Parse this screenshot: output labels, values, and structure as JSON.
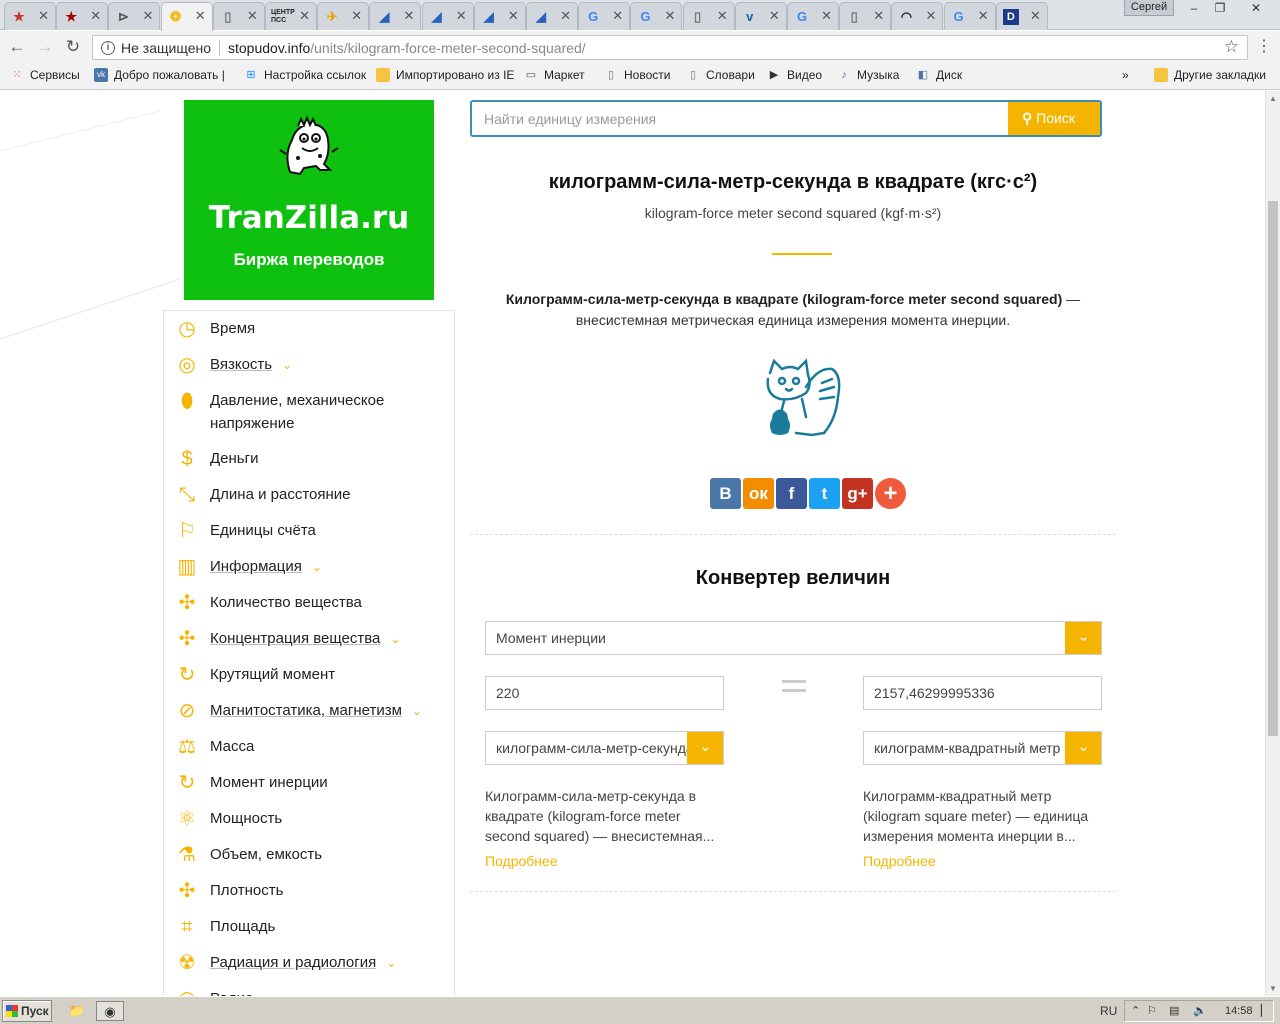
{
  "browser": {
    "tabs": [
      {
        "icon": "star-icon",
        "color": "#c0392b"
      },
      {
        "icon": "star-icon",
        "color": "#a00"
      },
      {
        "icon": "cursor-icon",
        "color": "#555"
      },
      {
        "icon": "bear-icon",
        "color": "#f5b400",
        "active": true
      },
      {
        "icon": "page-icon",
        "color": "#777"
      },
      {
        "icon": "ccc-logo-icon",
        "color": "#333",
        "text": "ЦЕНТР ПСС"
      },
      {
        "icon": "plane-icon",
        "color": "#f0a000"
      },
      {
        "icon": "z-logo-icon",
        "color": "#2a62b8"
      },
      {
        "icon": "z-logo-icon",
        "color": "#2a62b8"
      },
      {
        "icon": "z-logo-icon",
        "color": "#2a62b8"
      },
      {
        "icon": "z-logo-icon",
        "color": "#2a62b8"
      },
      {
        "icon": "google-icon",
        "color": "#4285f4"
      },
      {
        "icon": "google-icon",
        "color": "#4285f4"
      },
      {
        "icon": "page-icon",
        "color": "#777"
      },
      {
        "icon": "v-logo-icon",
        "color": "#1a5fa8"
      },
      {
        "icon": "google-icon",
        "color": "#4285f4"
      },
      {
        "icon": "page-icon",
        "color": "#777"
      },
      {
        "icon": "dark-logo-icon",
        "color": "#222"
      },
      {
        "icon": "google-icon",
        "color": "#4285f4"
      },
      {
        "icon": "d-logo-icon",
        "color": "#1a3a8a"
      }
    ],
    "user": "Сергей",
    "security_label": "Не защищено",
    "url_host": "stopudov.info",
    "url_path": "/units/kilogram-force-meter-second-squared/",
    "bookmarks": [
      {
        "label": "Сервисы",
        "icon": "apps-icon",
        "color": "#e74c3c"
      },
      {
        "label": "Добро пожаловать | ",
        "icon": "vk-icon",
        "color": "#4a76a8"
      },
      {
        "label": "Настройка ссылок",
        "icon": "windows-icon",
        "color": "#1e90ff"
      },
      {
        "label": "Импортировано из IE",
        "icon": "folder-icon",
        "color": "#f5c542"
      },
      {
        "label": "Маркет",
        "icon": "market-icon",
        "color": "#555"
      },
      {
        "label": "Новости",
        "icon": "page-icon",
        "color": "#777"
      },
      {
        "label": "Словари",
        "icon": "page-icon",
        "color": "#777"
      },
      {
        "label": "Видео",
        "icon": "video-icon",
        "color": "#333"
      },
      {
        "label": "Музыка",
        "icon": "music-icon",
        "color": "#4a76a8"
      },
      {
        "label": "Диск",
        "icon": "disk-icon",
        "color": "#4a76a8"
      }
    ],
    "more_bookmarks": "»",
    "other_bookmarks": "Другие закладки"
  },
  "ad": {
    "brand": "TranZilla.ru",
    "tagline": "Биржа переводов",
    "color": "#0fc10f"
  },
  "search": {
    "placeholder": "Найти единицу измерения",
    "button": "Поиск"
  },
  "unit": {
    "title": "килограмм-сила-метр-секунда в квадрате (кгс·с²)",
    "subtitle": "kilogram-force meter second squared (kgf·m·s²)",
    "desc_bold": "Килограмм-сила-метр-секунда в квадрате (kilogram-force meter second squared)",
    "desc_rest": " — внесистемная метрическая единица измерения момента инерции."
  },
  "social": [
    {
      "icon": "vk-icon",
      "text": "В",
      "color": "#4a76a8"
    },
    {
      "icon": "odnoklassniki-icon",
      "text": "ок",
      "color": "#f28c00"
    },
    {
      "icon": "facebook-icon",
      "text": "f",
      "color": "#3b5998"
    },
    {
      "icon": "twitter-icon",
      "text": "t",
      "color": "#1da1f2"
    },
    {
      "icon": "google-plus-icon",
      "text": "g+",
      "color": "#c23321"
    },
    {
      "icon": "plus-icon",
      "text": "+",
      "color": "#ef5a3c"
    }
  ],
  "categories": [
    {
      "label": "Время",
      "icon": "clock-icon",
      "dropdown": false
    },
    {
      "label": "Вязкость",
      "icon": "viscosity-icon",
      "dropdown": true
    },
    {
      "label": "Давление, механическое",
      "label2": "напряжение",
      "icon": "pressure-icon",
      "dropdown": false
    },
    {
      "label": "Деньги",
      "icon": "coin-icon",
      "dropdown": false
    },
    {
      "label": "Длина и расстояние",
      "icon": "ruler-icon",
      "dropdown": false
    },
    {
      "label": "Единицы счёта",
      "icon": "flag-icon",
      "dropdown": false
    },
    {
      "label": "Информация",
      "icon": "book-icon",
      "dropdown": true
    },
    {
      "label": "Количество вещества",
      "icon": "molecule-icon",
      "dropdown": false
    },
    {
      "label": "Концентрация вещества",
      "icon": "molecule-icon",
      "dropdown": true
    },
    {
      "label": "Крутящий момент",
      "icon": "rotate-icon",
      "dropdown": false
    },
    {
      "label": "Магнитостатика, магнетизм",
      "icon": "compass-icon",
      "dropdown": true
    },
    {
      "label": "Масса",
      "icon": "scales-icon",
      "dropdown": false
    },
    {
      "label": "Момент инерции",
      "icon": "rotate-icon",
      "dropdown": false
    },
    {
      "label": "Мощность",
      "icon": "atom-icon",
      "dropdown": false
    },
    {
      "label": "Объем, емкость",
      "icon": "flask-icon",
      "dropdown": false
    },
    {
      "label": "Плотность",
      "icon": "molecule-icon",
      "dropdown": false
    },
    {
      "label": "Площадь",
      "icon": "crop-icon",
      "dropdown": false
    },
    {
      "label": "Радиация и радиология",
      "icon": "radiation-icon",
      "dropdown": true
    },
    {
      "label": "Радио",
      "icon": "radio-icon",
      "dropdown": false
    }
  ],
  "converter": {
    "title": "Конвертер величин",
    "quantity": "Момент инерции",
    "from_value": "220",
    "to_value": "2157,46299995336",
    "from_unit": "килограмм-сила-метр-секунда",
    "to_unit": "килограмм-квадратный метр",
    "from_desc": "Килограмм-сила-метр-секунда в квадрате (kilogram-force meter second squared) — внесистемная...",
    "to_desc": "Килограмм-квадратный метр (kilogram square meter) — единица измерения момента инерции в...",
    "more": "Подробнее"
  },
  "accent_color": "#f5b400",
  "taskbar": {
    "start": "Пуск",
    "lang": "RU",
    "time": "14:58"
  }
}
